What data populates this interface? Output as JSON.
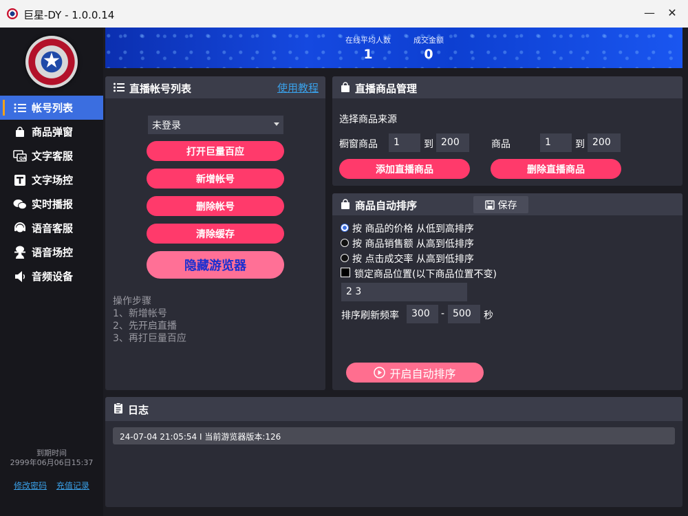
{
  "window": {
    "title": "巨星-DY - 1.0.0.14",
    "minimize": "—",
    "close": "✕"
  },
  "sidebar": {
    "items": [
      {
        "label": "帐号列表",
        "icon": "list-icon"
      },
      {
        "label": "商品弹窗",
        "icon": "shopping-bag-icon"
      },
      {
        "label": "文字客服",
        "icon": "chat-qa-icon"
      },
      {
        "label": "文字场控",
        "icon": "text-t-icon"
      },
      {
        "label": "实时播报",
        "icon": "wechat-bubbles-icon"
      },
      {
        "label": "语音客服",
        "icon": "headset-icon"
      },
      {
        "label": "语音场控",
        "icon": "microphone-person-icon"
      },
      {
        "label": "音频设备",
        "icon": "speaker-icon"
      }
    ],
    "expire_label": "到期时间",
    "expire_value": "2999年06月06日15:37",
    "change_password": "修改密码",
    "recharge_record": "充值记录"
  },
  "banner": {
    "avg_online_label": "在线平均人数",
    "avg_online_value": "1",
    "deal_amount_label": "成交金额",
    "deal_amount_value": "0"
  },
  "accounts": {
    "title": "直播帐号列表",
    "tutorial": "使用教程",
    "select_value": "未登录",
    "open_button": "打开巨量百应",
    "add_button": "新增帐号",
    "delete_button": "删除帐号",
    "clear_button": "清除缓存",
    "hide_button": "隐藏游览器",
    "steps": [
      "操作步骤",
      "1、新增帐号",
      "2、先开启直播",
      "3、再打巨量百应"
    ]
  },
  "products": {
    "title": "直播商品管理",
    "source_label": "选择商品来源",
    "window_label": "橱窗商品",
    "window_from": "1",
    "to_label": "到",
    "window_to": "200",
    "product_label": "商品",
    "product_from": "1",
    "product_to": "200",
    "add_button": "添加直播商品",
    "delete_button": "删除直播商品"
  },
  "sorting": {
    "title": "商品自动排序",
    "save": "保存",
    "options": [
      {
        "label": "按 商品的价格 从低到高排序",
        "selected": true
      },
      {
        "label": "按 商品销售额 从高到低排序",
        "selected": false
      },
      {
        "label": "按 点击成交率 从高到低排序",
        "selected": false
      }
    ],
    "lock_label": "锁定商品位置(以下商品位置不变)",
    "lock_value": "2 3",
    "refresh_label": "排序刷新频率",
    "refresh_min": "300",
    "dash": "-",
    "refresh_max": "500",
    "unit": "秒",
    "start_button": "开启自动排序"
  },
  "log": {
    "title": "日志",
    "lines": [
      "24-07-04 21:05:54 I  当前游览器版本:126"
    ]
  },
  "colors": {
    "accent": "#3b6ee0",
    "pink": "#ff3a6b",
    "link": "#3aa0e8",
    "active_marker": "#f3a21b"
  }
}
